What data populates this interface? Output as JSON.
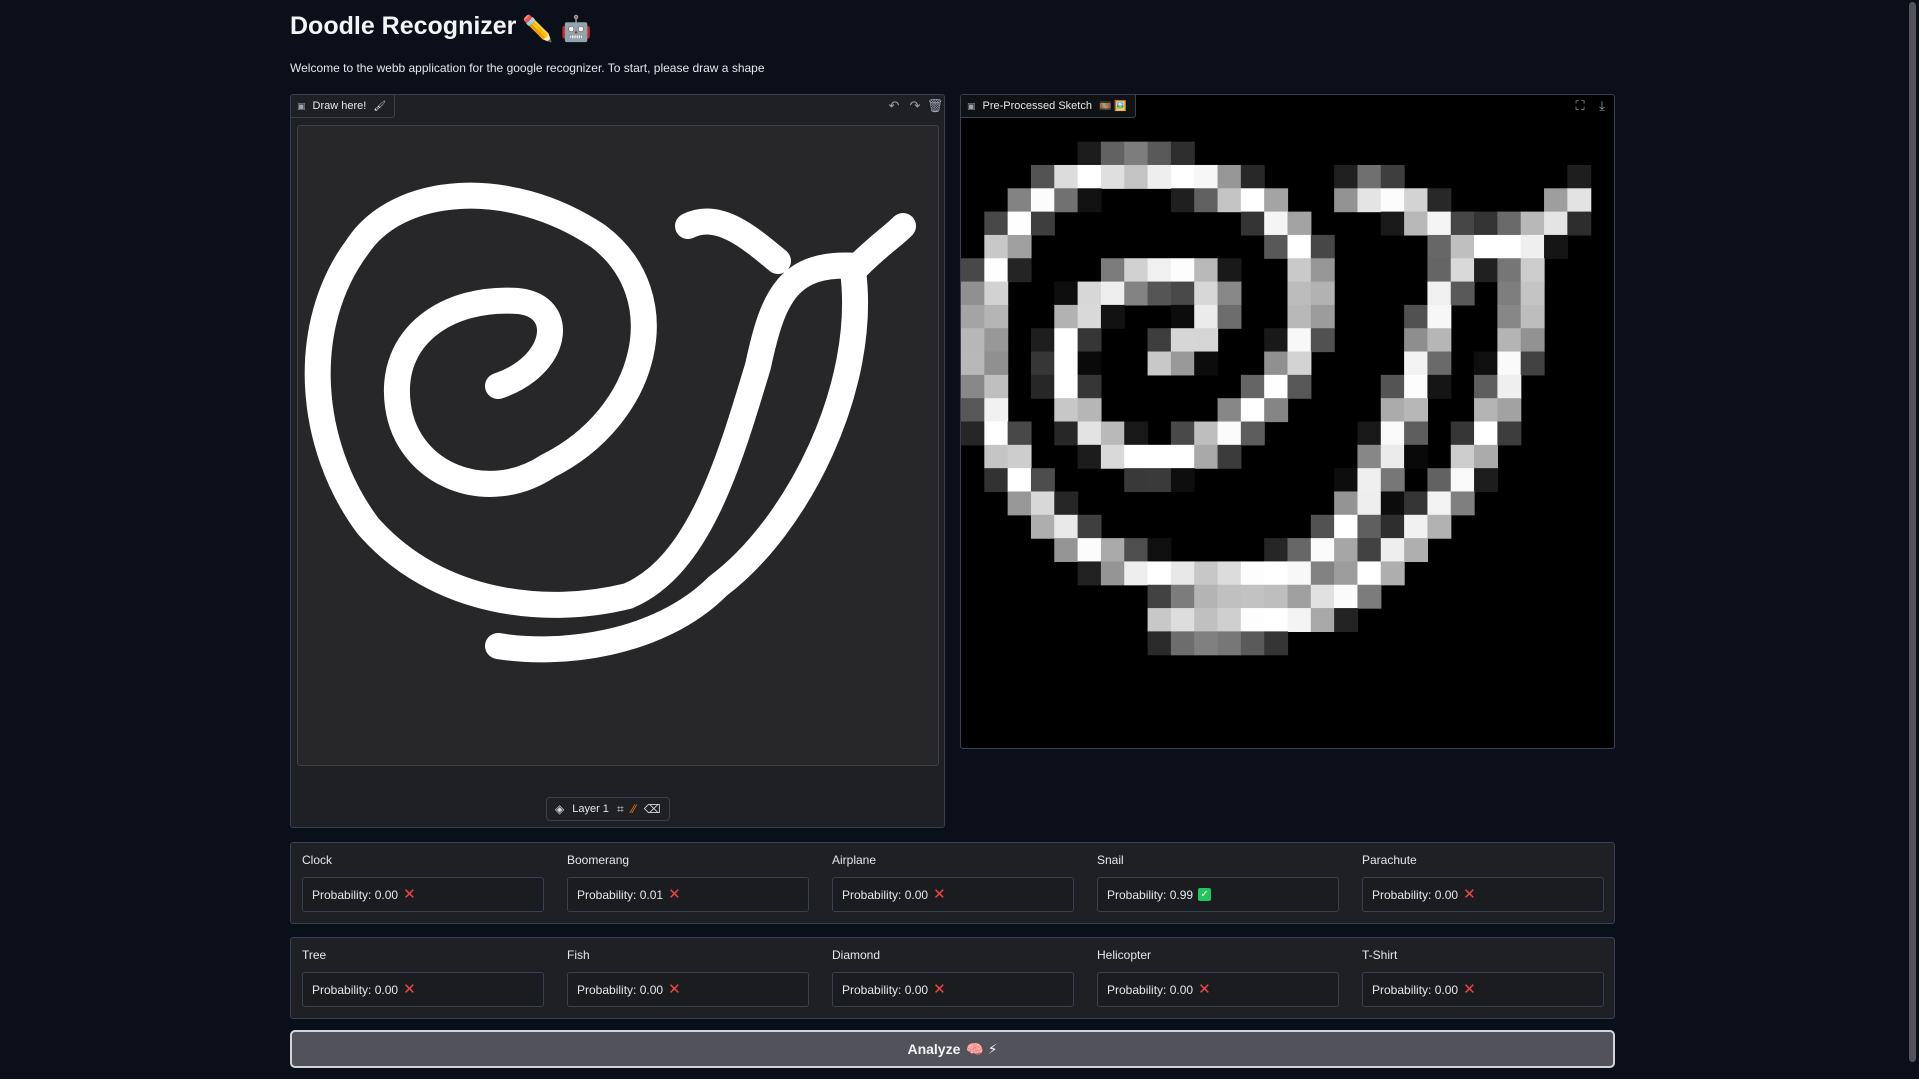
{
  "header": {
    "title": "Doodle Recognizer",
    "title_emojis": "✏️ 🤖",
    "description": "Welcome to the webb application for the google recognizer. To start, please draw a shape"
  },
  "sketchpad": {
    "label": "Draw here!",
    "label_icon": "brush-icon",
    "toolbar": [
      "undo-icon",
      "redo-icon",
      "trash-icon"
    ],
    "layer_label": "Layer 1",
    "tools": [
      "layers-icon",
      "crop-icon",
      "brush-icon",
      "eraser-icon"
    ]
  },
  "preprocessed": {
    "label": "Pre-Processed Sketch",
    "label_icons": "🎞️ 🖼️",
    "toolbar": [
      "fullscreen-icon",
      "download-icon"
    ]
  },
  "results_row1": [
    {
      "label": "Clock",
      "value": "Probability: 0.00",
      "match": false
    },
    {
      "label": "Boomerang",
      "value": "Probability: 0.01",
      "match": false
    },
    {
      "label": "Airplane",
      "value": "Probability: 0.00",
      "match": false
    },
    {
      "label": "Snail",
      "value": "Probability: 0.99",
      "match": true
    },
    {
      "label": "Parachute",
      "value": "Probability: 0.00",
      "match": false
    }
  ],
  "results_row2": [
    {
      "label": "Tree",
      "value": "Probability: 0.00",
      "match": false
    },
    {
      "label": "Fish",
      "value": "Probability: 0.00",
      "match": false
    },
    {
      "label": "Diamond",
      "value": "Probability: 0.00",
      "match": false
    },
    {
      "label": "Helicopter",
      "value": "Probability: 0.00",
      "match": false
    },
    {
      "label": "T-Shirt",
      "value": "Probability: 0.00",
      "match": false
    }
  ],
  "analyze_button": {
    "label": "Analyze",
    "emojis": "🧠 ⚡"
  },
  "colors": {
    "background": "#0b0f19",
    "panel": "#1f2023",
    "border": "#374151",
    "match": "#22c55e",
    "no_match": "#ef4444"
  }
}
